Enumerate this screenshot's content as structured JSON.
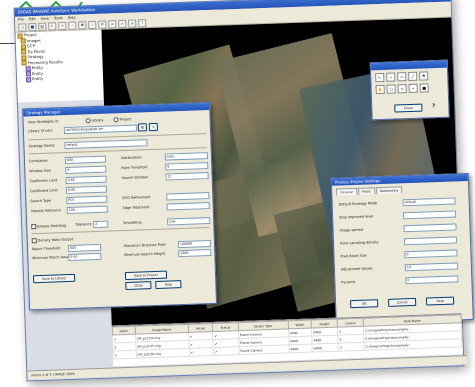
{
  "app": {
    "title": "ERDAS IMAGINE AutoSync Workstation",
    "menu": [
      "File",
      "Edit",
      "View",
      "Tools",
      "Help"
    ]
  },
  "toolbar_icons": [
    "open-icon",
    "save-icon",
    "print-icon",
    "arrow-icon",
    "zoom-in-icon",
    "zoom-out-icon",
    "pan-icon",
    "info-icon",
    "grid-icon",
    "link-icon",
    "close-icon",
    "layers-icon",
    "help-icon"
  ],
  "tree": {
    "items": [
      "Project",
      "Images",
      "GCP",
      "Tie Points",
      "Strategy",
      "Processing Results",
      "Entity",
      "Entity",
      "Entity"
    ]
  },
  "tools_palette": {
    "title": "",
    "close_label": "Close",
    "help_label": "?"
  },
  "strategy_dialog": {
    "title": "Strategy Manager",
    "view_label": "View Strategies in:",
    "radio_library": "Library",
    "radio_project": "Project",
    "library_label": "Library (if set):",
    "library_value": "ob702strategy@lab.ser",
    "strategy_name_label": "Strategy Name:",
    "strategy_name_value": "default",
    "fields_left": [
      {
        "label": "Correlation",
        "value": "800"
      },
      {
        "label": "Window Size",
        "value": "9"
      },
      {
        "label": "Coefficient Limit",
        "value": "0.80"
      },
      {
        "label": "Coefficient Limit",
        "value": "0.80"
      },
      {
        "label": "Search Type",
        "value": "POI"
      },
      {
        "label": "Interest Tolerance",
        "value": "100"
      }
    ],
    "fields_right": [
      {
        "label": "Initialization",
        "value": "auto"
      },
      {
        "label": "Point Threshold",
        "value": "9"
      },
      {
        "label": "Search Window",
        "value": "11"
      },
      {
        "label": "",
        "value": ""
      },
      {
        "label": "GCG Refinement",
        "value": ""
      },
      {
        "label": "Edge Treatment",
        "value": ""
      }
    ],
    "browse_label": "Browse Matching",
    "tolerance_label": "Tolerance",
    "tolerance_value": "2",
    "smoothing_label": "Smoothing",
    "smoothing_value": "Low",
    "density_label": "Density Ratio Output",
    "reject_label": "Reject Threshold",
    "reject_value": "800",
    "min_label": "Minimum Match Area",
    "min_value": "0.50",
    "max_diff_label": "Maximum Distance Pixel",
    "max_diff_value": "100000",
    "max_height_label": "Minimum Search Height",
    "max_height_value": "1000",
    "save_library_label": "Save to Library",
    "save_project_label": "Save to Project",
    "close_label": "Close",
    "help_label": "Help"
  },
  "process_dialog": {
    "title": "Process Engine Settings",
    "tabs": [
      "General",
      "Pixels",
      "Radiometry"
    ],
    "fields": [
      {
        "label": "Default Strategy Mode",
        "value": "default"
      },
      {
        "label": "Stop improved level",
        "value": ""
      },
      {
        "label": "Image spread",
        "value": ""
      },
      {
        "label": "Point sampling density",
        "value": ""
      },
      {
        "label": "Pixel Block Size",
        "value": "0"
      },
      {
        "label": "Adjustment Values",
        "value": "10"
      },
      {
        "label": "Pyramid",
        "value": "0"
      }
    ],
    "ok_label": "OK",
    "cancel_label": "Cancel",
    "help_label": "Help"
  },
  "grid": {
    "headers": [
      "Index",
      "Image Name",
      "Active",
      "Status",
      "Sensor Type",
      "Width",
      "Height",
      "Layers",
      "Data Name"
    ],
    "rows": [
      [
        "1",
        "CM_p12r34.img",
        "✔",
        "✔",
        "Frame Camera",
        "6400",
        "6400",
        "3",
        "C:/ImagineProjects/example/..."
      ],
      [
        "2",
        "CM_p12r35.img",
        "✔",
        "✔",
        "Frame Camera",
        "6400",
        "6400",
        "3",
        "C:/ImagineProjects/example/..."
      ],
      [
        "3",
        "CM_p12r36.img",
        "✔",
        "✔",
        "Frame Camera",
        "6400",
        "6400",
        "3",
        "C:/ImagineProjects/example/..."
      ]
    ]
  },
  "status": {
    "text": "Frame 1 of 3  |  IMAGE 100%"
  },
  "colors": {
    "titlebar": "#2453b8",
    "dialog": "#ece9d8",
    "logo_green": "#2aa84a"
  }
}
